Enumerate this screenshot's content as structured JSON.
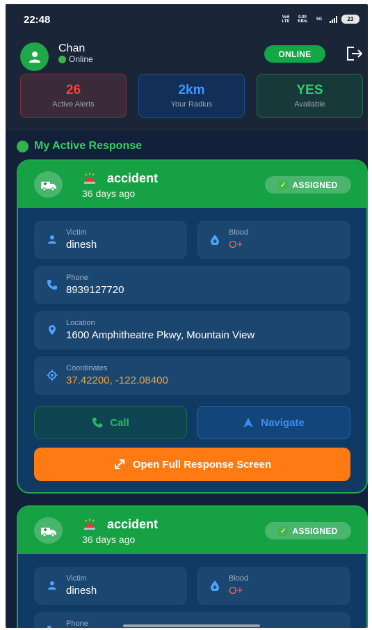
{
  "status_bar": {
    "time": "22:48",
    "network_1": "Vo6 LTE",
    "speed": "0.00 KB/s",
    "network_2": "5G",
    "battery": "23"
  },
  "header": {
    "user_name": "Chan",
    "user_status": "Online",
    "online_badge": "ONLINE"
  },
  "stats": [
    {
      "value": "26",
      "label": "Active Alerts"
    },
    {
      "value": "2km",
      "label": "Your Radius"
    },
    {
      "value": "YES",
      "label": "Available"
    }
  ],
  "section_title": "My Active Response",
  "cards": [
    {
      "type": "accident",
      "time_ago": "36 days ago",
      "status": "ASSIGNED",
      "victim_label": "Victim",
      "victim": "dinesh",
      "blood_label": "Blood",
      "blood": "O+",
      "phone_label": "Phone",
      "phone": "8939127720",
      "location_label": "Location",
      "location": "1600 Amphitheatre Pkwy, Mountain View",
      "coordinates_label": "Coordinates",
      "coordinates": "37.42200, -122.08400",
      "call_label": "Call",
      "navigate_label": "Navigate",
      "open_label": "Open Full Response Screen"
    },
    {
      "type": "accident",
      "time_ago": "36 days ago",
      "status": "ASSIGNED",
      "victim_label": "Victim",
      "victim": "dinesh",
      "blood_label": "Blood",
      "blood": "O+",
      "phone_label": "Phone"
    }
  ],
  "colors": {
    "background": "#12203a",
    "accent_green": "#16a144",
    "alert_red": "#ff3b3b",
    "radius_blue": "#3e96ff",
    "available_green": "#2ed06e",
    "open_button_orange": "#ff7a12"
  }
}
